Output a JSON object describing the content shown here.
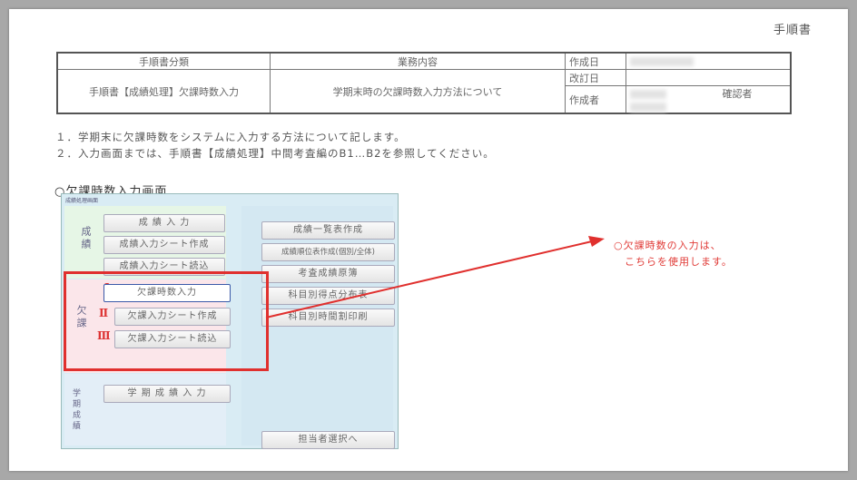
{
  "doc_type": "手順書",
  "meta": {
    "h_category": "手順書分類",
    "h_content": "業務内容",
    "category_value": "手順書【成績処理】欠課時数入力",
    "content_value": "学期末時の欠課時数入力方法について",
    "created_label": "作成日",
    "revised_label": "改訂日",
    "author_label": "作成者",
    "checker_label": "確認者"
  },
  "notes": [
    "１．学期末に欠課時数をシステムに入力する方法について記します。",
    "２．入力画面までは、手順書【成績処理】中間考査編のB1…B2を参照してください。"
  ],
  "section_heading": "○欠課時数入力画面",
  "screen": {
    "title": "成績処理画面",
    "group_top_label": "成績",
    "group_mid_label": "欠課",
    "group_bot_label": "学期成績",
    "btn_seiseki_nyuryoku": "成 績 入 力",
    "btn_seiseki_sheet_sakusei": "成績入力シート作成",
    "btn_seiseki_sheet_yomikomi": "成績入力シート読込",
    "btn_kekka_nyuryoku": "欠課時数入力",
    "btn_kekka_sheet_sakusei": "欠課入力シート作成",
    "btn_kekka_sheet_yomikomi": "欠課入力シート読込",
    "btn_gakki_seiseki": "学 期 成 績 入 力",
    "btn_r1": "成績一覧表作成",
    "btn_r2": "成績順位表作成(個別/全体)",
    "btn_r3": "考査成績原簿",
    "btn_r4": "科目別得点分布表",
    "btn_r5": "科目別時間割印刷",
    "btn_r6": "担当者選択へ",
    "roman1": "Ⅰ",
    "roman2": "Ⅱ",
    "roman3": "Ⅲ"
  },
  "callout": {
    "line1": "○欠課時数の入力は、",
    "line2": "こちらを使用します。"
  },
  "colors": {
    "highlight": "#e0302e"
  }
}
